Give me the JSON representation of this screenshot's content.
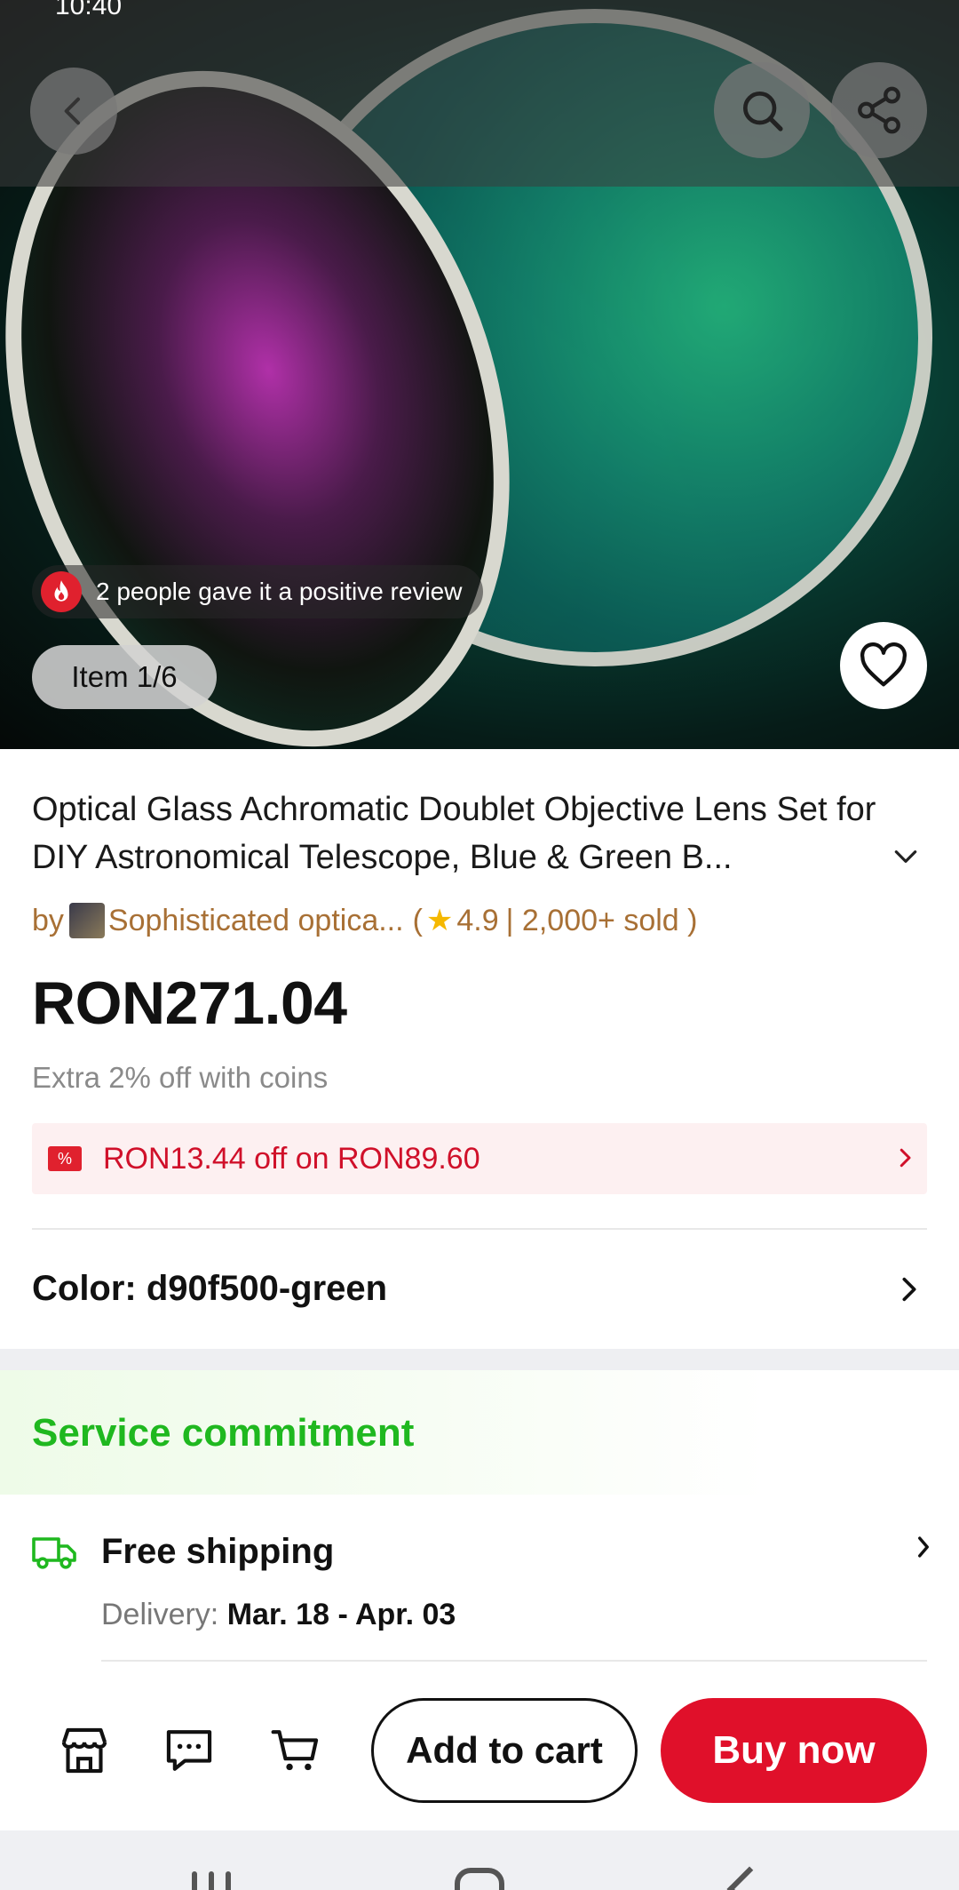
{
  "status_bar": {
    "time": "10:40"
  },
  "gallery": {
    "review_badge": "2 people gave it a positive review",
    "item_counter": "Item 1/6"
  },
  "product": {
    "title": "Optical Glass Achromatic Doublet Objective Lens Set for DIY Astronomical Telescope, Blue & Green B...",
    "seller_prefix": "by",
    "seller_name": "Sophisticated optica...",
    "rating_open": "(",
    "rating": "4.9",
    "sold": "| 2,000+ sold )",
    "price": "RON271.04",
    "coins_note": "Extra 2% off with coins",
    "coupon": "RON13.44 off on RON89.60",
    "coupon_tag": "%",
    "color_label": "Color: d90f500-green"
  },
  "service": {
    "title": "Service commitment",
    "shipping_title": "Free shipping",
    "delivery_label": "Delivery:",
    "delivery_dates": "Mar. 18 - Apr. 03"
  },
  "actions": {
    "add_to_cart": "Add to cart",
    "buy_now": "Buy now"
  },
  "icons": {
    "back": "chevron-left-icon",
    "search": "search-icon",
    "share": "share-icon",
    "favorite": "heart-icon",
    "store": "store-icon",
    "message": "chat-icon",
    "cart": "cart-icon",
    "shipping": "truck-icon"
  },
  "colors": {
    "primary_red": "#e0102a",
    "service_green": "#1fb81f",
    "seller_brown": "#a87035",
    "star_gold": "#f5b800"
  }
}
